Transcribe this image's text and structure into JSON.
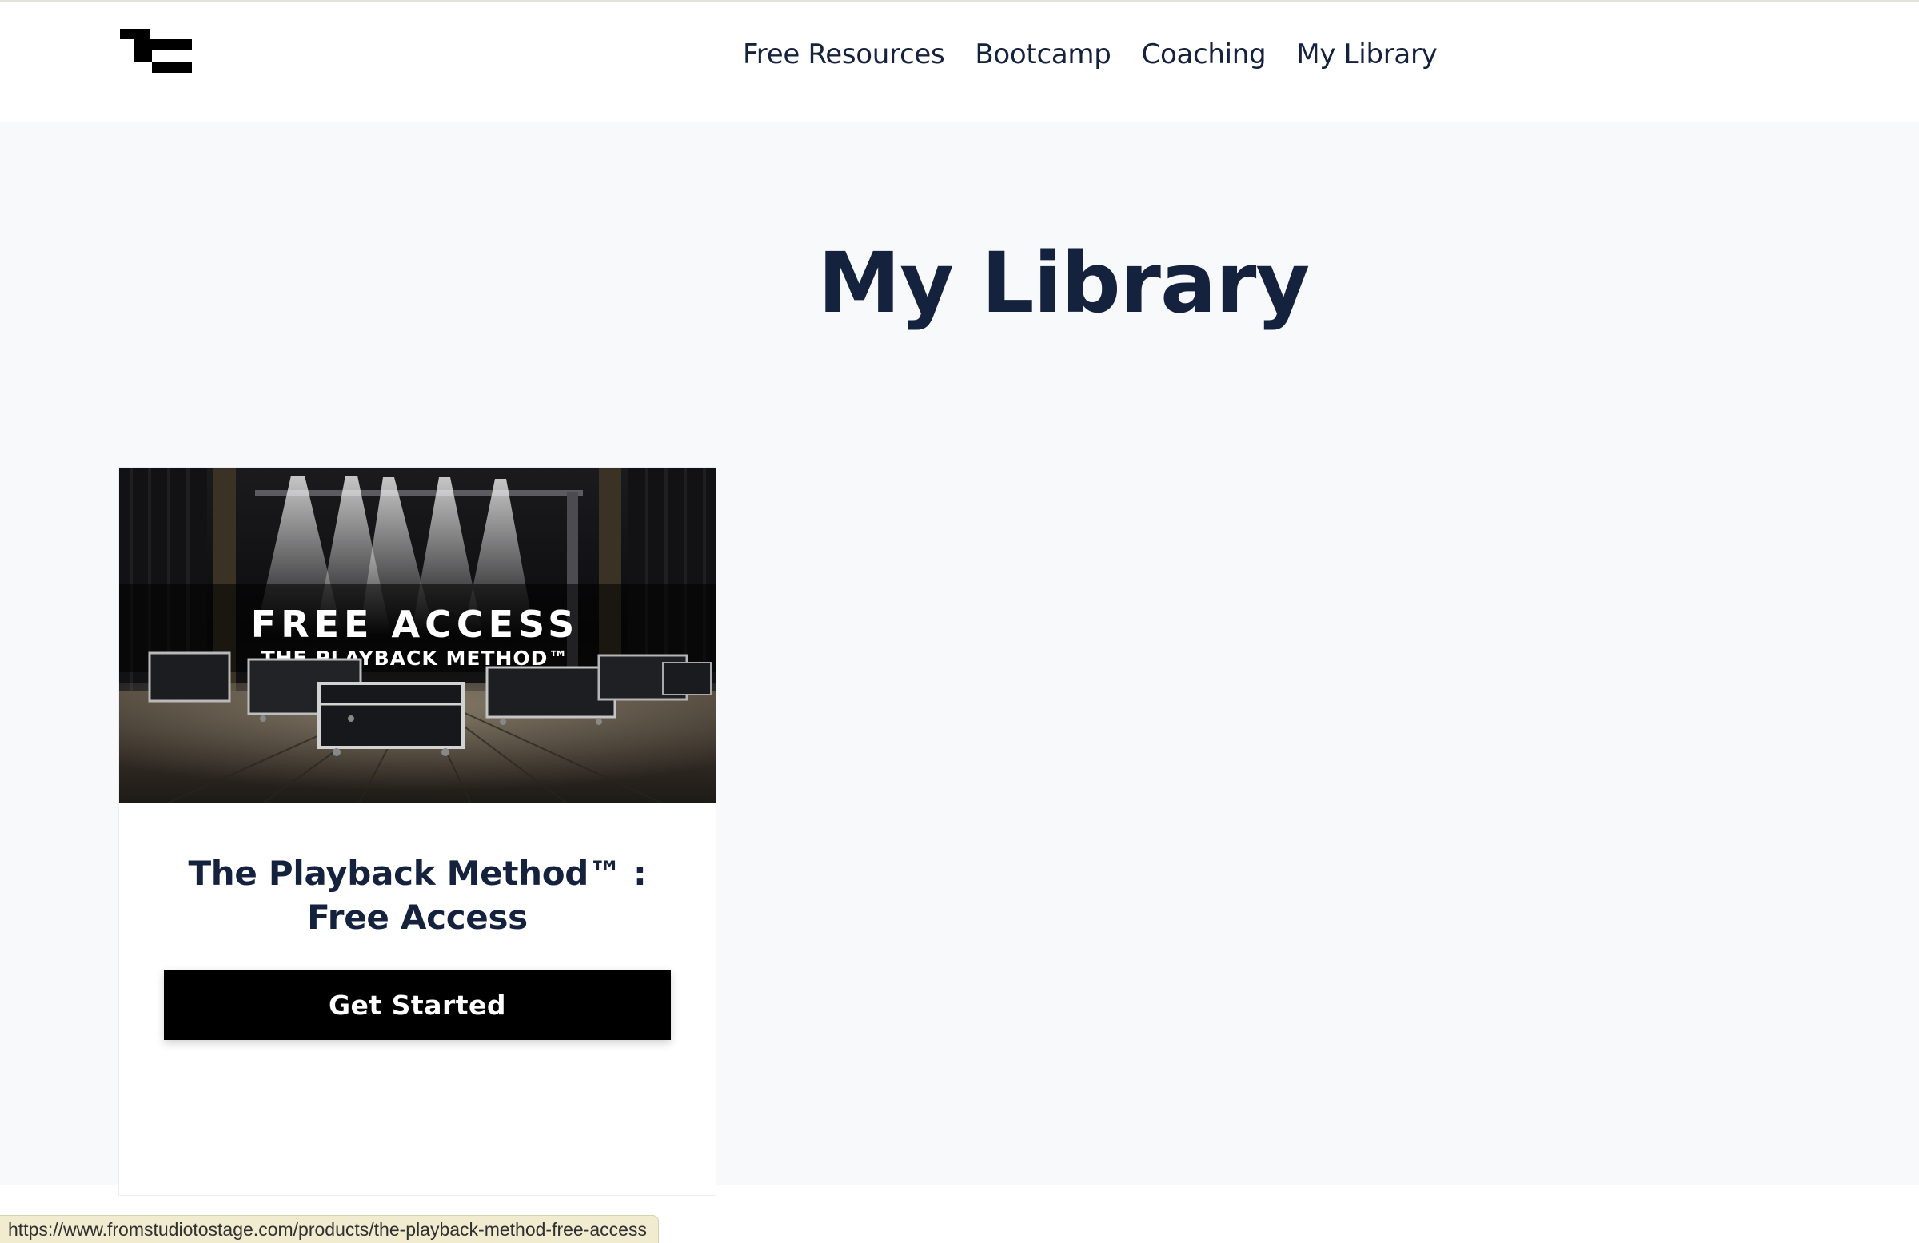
{
  "header": {
    "logo_icon": "bars-logo-icon",
    "nav": [
      {
        "label": "Free Resources"
      },
      {
        "label": "Bootcamp"
      },
      {
        "label": "Coaching"
      },
      {
        "label": "My Library"
      }
    ]
  },
  "page": {
    "title": "My Library"
  },
  "product": {
    "image_text": {
      "line1": "FREE ACCESS",
      "line2": "THE PLAYBACK METHOD™"
    },
    "title_line1": "The Playback Method™ :",
    "title_line2": "Free Access",
    "button_label": "Get Started"
  },
  "status_bar": {
    "url": "https://www.fromstudiotostage.com/products/the-playback-method-free-access"
  },
  "colors": {
    "text_navy": "#15223e",
    "page_background": "#f8f9fb",
    "button_black": "#000000"
  }
}
